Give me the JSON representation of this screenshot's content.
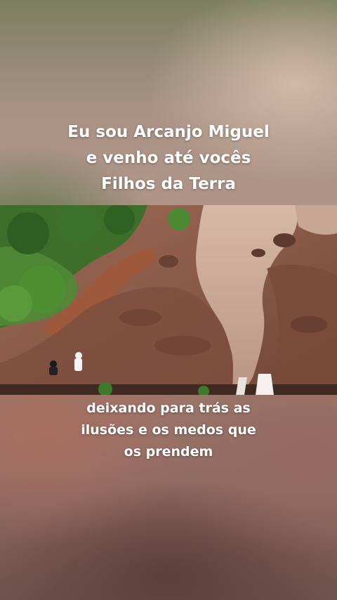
{
  "caption_top": {
    "line1": "Eu sou Arcanjo Miguel",
    "line2": "e venho até vocês",
    "line3": "Filhos da Terra"
  },
  "caption_bottom": {
    "line1": "deixando para trás as",
    "line2": "ilusões e os medos que",
    "line3": "os prendem"
  },
  "colors": {
    "caption_text": "#ffffff",
    "rock": "#8a5a48",
    "water": "#c9a896",
    "vegetation": "#3f7a2c"
  }
}
